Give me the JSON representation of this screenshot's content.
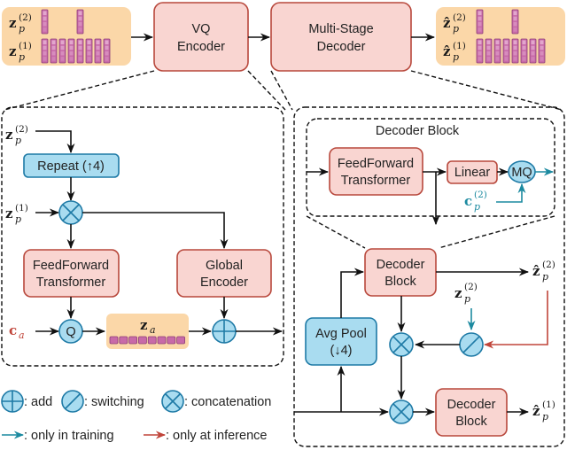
{
  "top_row": {
    "input_group": {
      "rows": [
        {
          "symbol": "z",
          "sub": "p",
          "sup": "(2)",
          "tokens": 2
        },
        {
          "symbol": "z",
          "sub": "p",
          "sup": "(1)",
          "tokens": 8
        }
      ]
    },
    "vq_encoder": {
      "line1": "VQ",
      "line2": "Encoder"
    },
    "decoder": {
      "line1": "Multi-Stage",
      "line2": "Decoder"
    },
    "output_group": {
      "rows": [
        {
          "symbol": "ẑ",
          "sub": "p",
          "sup": "(2)",
          "tokens": 2
        },
        {
          "symbol": "ẑ",
          "sub": "p",
          "sup": "(1)",
          "tokens": 8
        }
      ]
    }
  },
  "encoder_detail": {
    "input_top": {
      "symbol": "z",
      "sub": "p",
      "sup": "(2)"
    },
    "input_mid": {
      "symbol": "z",
      "sub": "p",
      "sup": "(1)"
    },
    "repeat": "Repeat (↑4)",
    "ff_transformer": {
      "line1": "FeedForward",
      "line2": "Transformer"
    },
    "global_encoder": {
      "line1": "Global",
      "line2": "Encoder"
    },
    "ca": {
      "symbol": "c",
      "sub": "a"
    },
    "quantizer": "Q",
    "za": {
      "symbol": "z",
      "sub": "a",
      "tokens": 8
    }
  },
  "decoder_detail": {
    "block_title": "Decoder Block",
    "ff_transformer": {
      "line1": "FeedForward",
      "line2": "Transformer"
    },
    "linear": "Linear",
    "mq": "MQ",
    "cp": {
      "symbol": "c",
      "sub": "p",
      "sup": "(2)"
    },
    "decoder_block_top": {
      "line1": "Decoder",
      "line2": "Block"
    },
    "decoder_block_bottom": {
      "line1": "Decoder",
      "line2": "Block"
    },
    "avg_pool": {
      "line1": "Avg Pool",
      "line2": "(↓4)"
    },
    "zp2_in": {
      "symbol": "z",
      "sub": "p",
      "sup": "(2)"
    },
    "out2": {
      "symbol": "ẑ",
      "sub": "p",
      "sup": "(2)"
    },
    "out1": {
      "symbol": "ẑ",
      "sub": "p",
      "sup": "(1)"
    }
  },
  "legend": {
    "add": ": add",
    "switching": ": switching",
    "concat": ": concatenation",
    "training": ": only in training",
    "inference": ": only at inference"
  },
  "colors": {
    "teal": "#1c8aa0",
    "red": "#c0453a",
    "block_fill": "#f9d5d1",
    "op_fill": "#a9dcf0",
    "token_group": "#fbd7a8"
  }
}
